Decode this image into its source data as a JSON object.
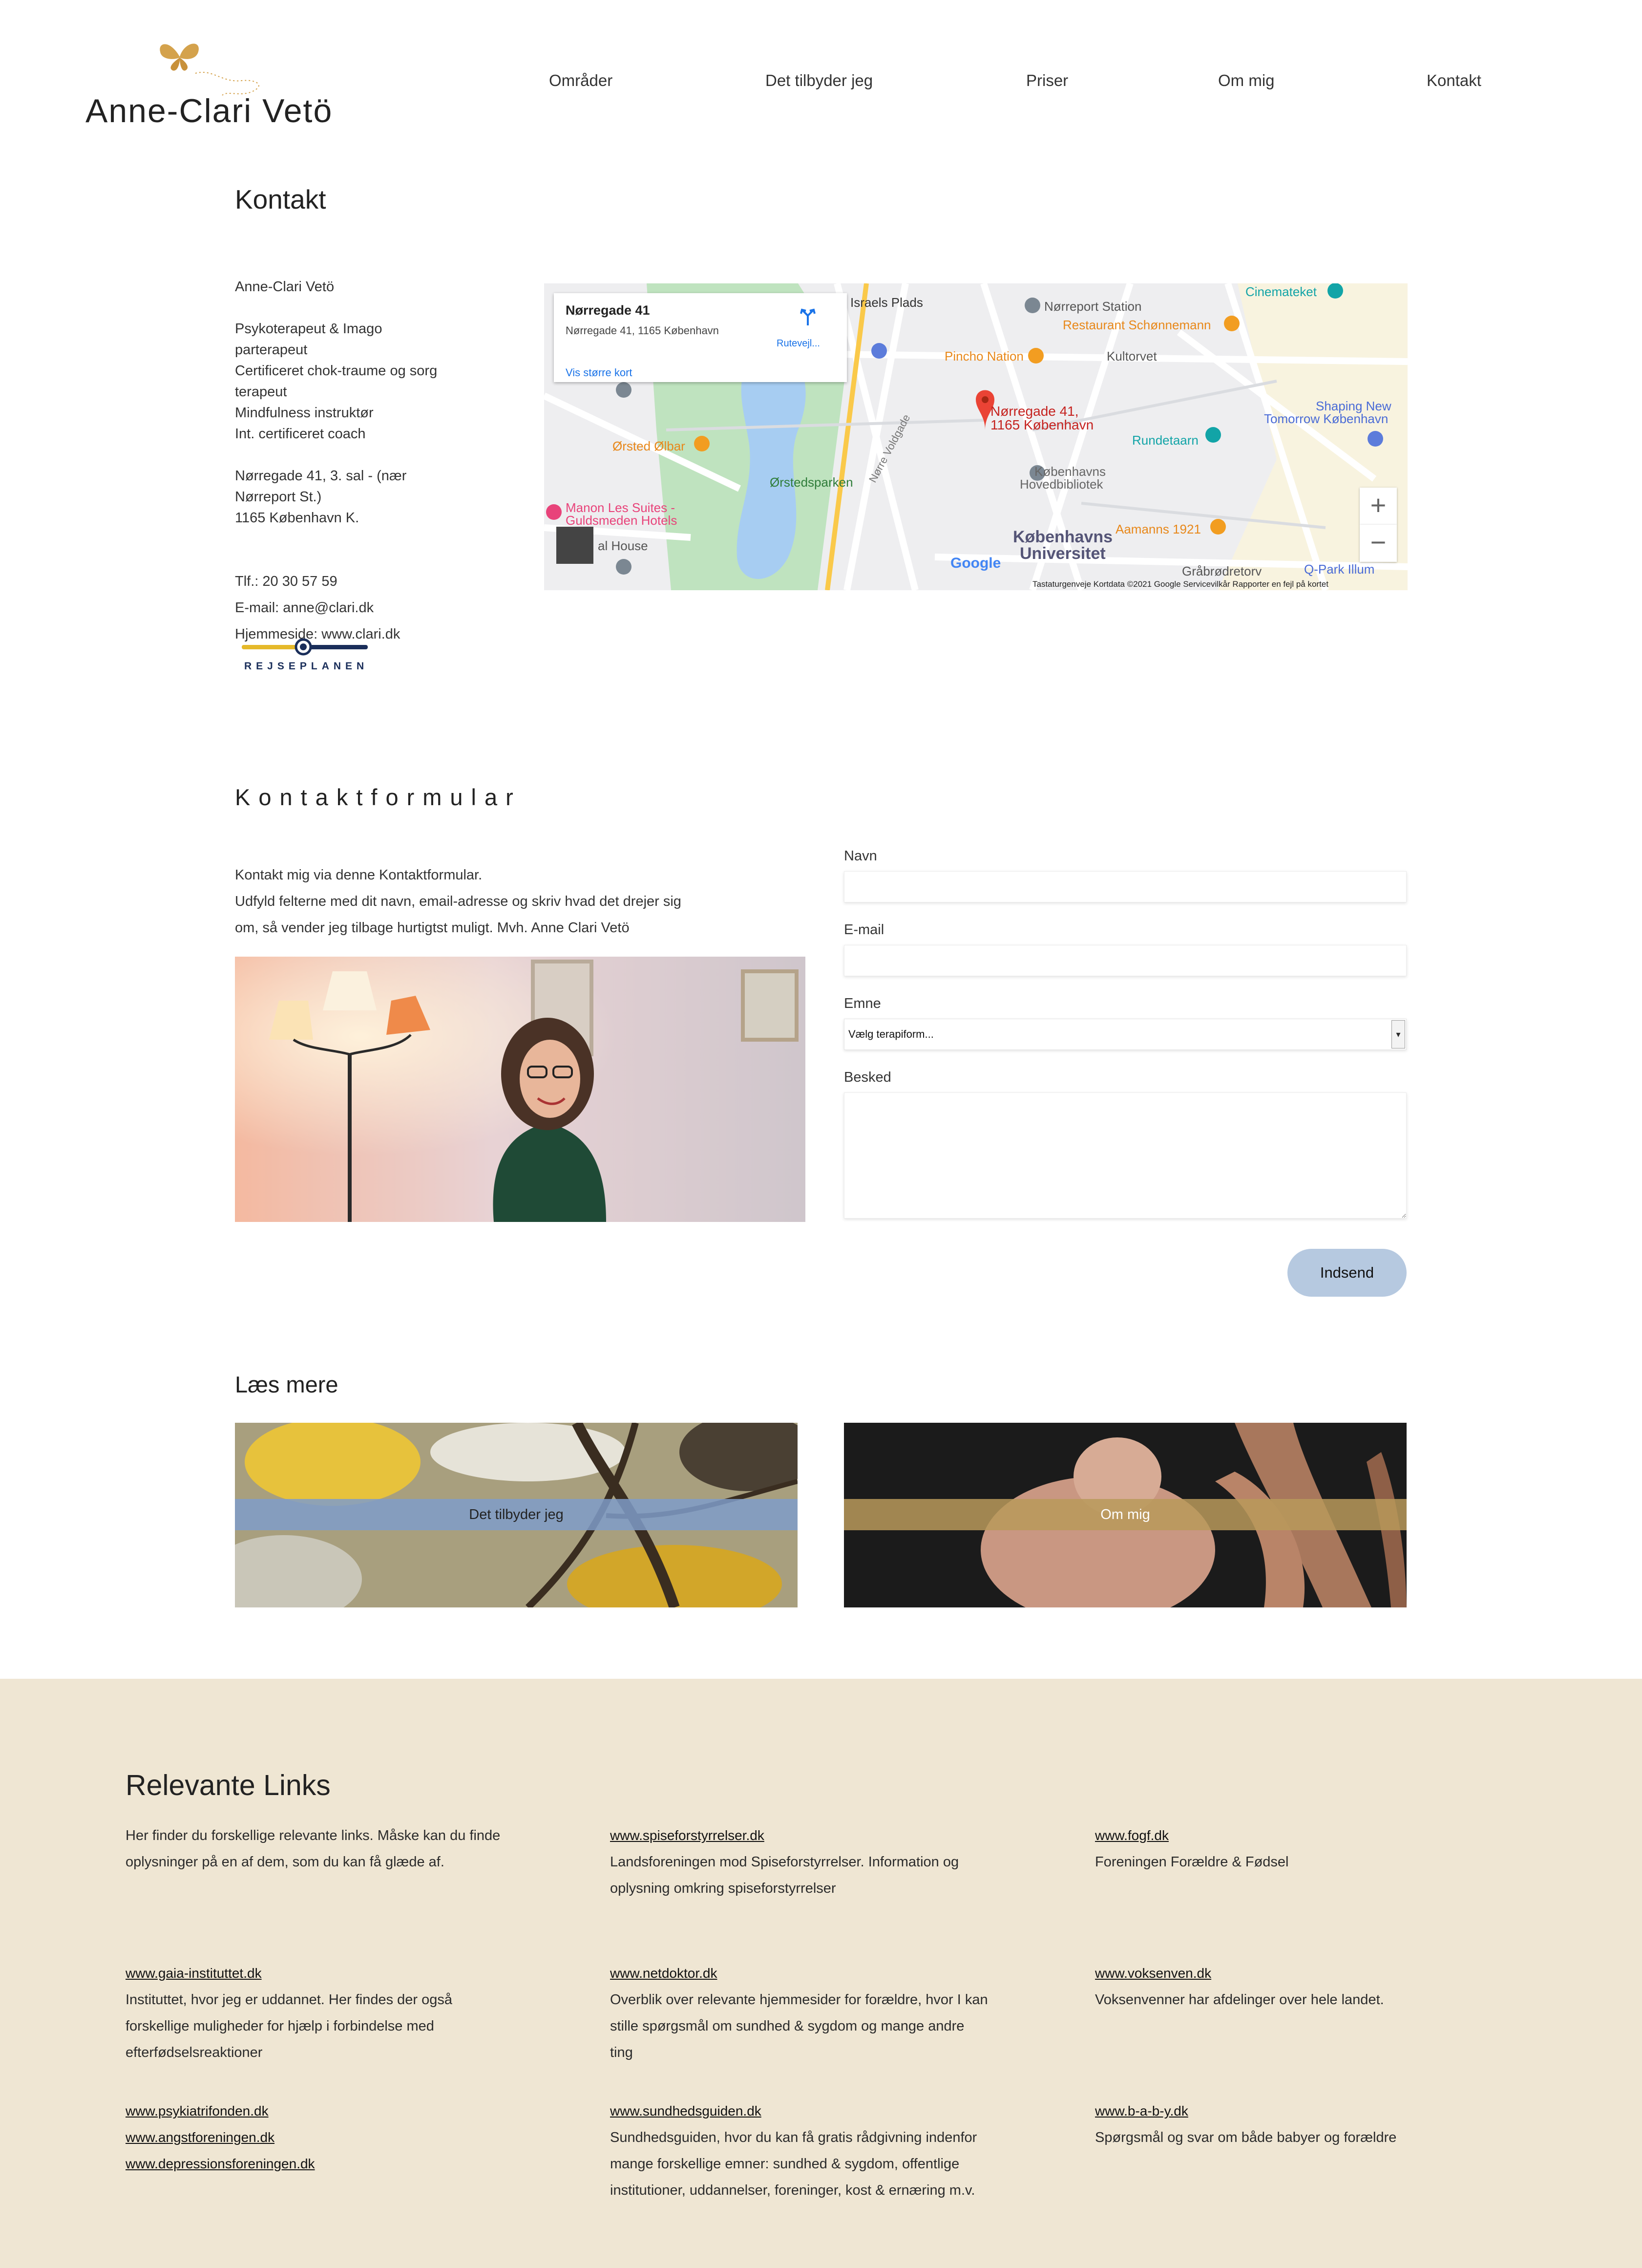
{
  "header": {
    "logo_name": "Anne-Clari Vetö",
    "nav": [
      "Områder",
      "Det tilbyder jeg",
      "Priser",
      "Om mig",
      "Kontakt"
    ]
  },
  "page_title": "Kontakt",
  "contact": {
    "name": "Anne-Clari Vetö",
    "titles": [
      "Psykoterapeut & Imago",
      "parterapeut",
      "Certificeret chok-traume og sorg",
      "terapeut",
      "Mindfulness instruktør",
      "Int. certificeret coach"
    ],
    "address": [
      "Nørregade 41, 3. sal - (nær",
      "Nørreport St.)",
      "1165 København K."
    ],
    "phone": "Tlf.: 20 30 57 59",
    "email": "E-mail: anne@clari.dk",
    "website": "Hjemmeside: www.clari.dk",
    "rejseplanen": "REJSEPLANEN"
  },
  "map": {
    "card_title": "Nørregade 41",
    "card_address": "Nørregade 41, 1165 København",
    "card_link": "Vis større kort",
    "route_label": "Rutevejl...",
    "pin_label_1": "Nørregade 41,",
    "pin_label_2": "1165 København",
    "labels": {
      "israels_plads": "Israels Plads",
      "norreport_station": "Nørreport Station",
      "cinemateket": "Cinemateket",
      "restaurant": "Restaurant Schønnemann",
      "pincho": "Pincho Nation",
      "kultorvet": "Kultorvet",
      "orsted_olbar": "Ørsted Ølbar",
      "orstedsparken": "Ørstedsparken",
      "rundetaarn": "Rundetaarn",
      "shaping_1": "Shaping New",
      "shaping_2": "Tomorrow København",
      "kbh_hovedbib_1": "Københavns",
      "kbh_hovedbib_2": "Hovedbibliotek",
      "kbh_uni_1": "Københavns",
      "kbh_uni_2": "Universitet",
      "aamanns": "Aamanns 1921",
      "manon_1": "Manon Les Suites -",
      "manon_2": "Guldsmeden Hotels",
      "noerre_voldgade": "Nørre Voldgade",
      "grabrodretorv": "Gråbrødretorv",
      "qpark": "Q-Park Illum",
      "ral_house": "al House",
      "google": "Google"
    },
    "footer": "Tastaturgenveje    Kortdata ©2021 Google    Servicevilkår    Rapporter en fejl på kortet",
    "zoom_in": "+",
    "zoom_out": "−"
  },
  "form_section": {
    "title": "Kontaktformular",
    "intro": [
      "Kontakt mig via denne Kontaktformular.",
      "Udfyld felterne med dit navn, email-adresse og skriv hvad det drejer sig",
      "om, så vender jeg tilbage hurtigtst muligt. Mvh. Anne Clari Vetö"
    ],
    "labels": {
      "name": "Navn",
      "email": "E-mail",
      "subject": "Emne",
      "message": "Besked"
    },
    "values": {
      "name": "",
      "email": "",
      "message": ""
    },
    "subject_selected": "Vælg terapiform...",
    "submit": "Indsend"
  },
  "read_more": {
    "title": "Læs mere",
    "cards": [
      "Det tilbyder jeg",
      "Om mig"
    ]
  },
  "footer": {
    "title": "Relevante Links",
    "intro": [
      "Her finder du forskellige relevante links. Måske kan du finde",
      "oplysninger på en af dem, som du kan få glæde af."
    ],
    "links": [
      {
        "url": "www.spiseforstyrrelser.dk",
        "desc": [
          "Landsforeningen mod Spiseforstyrrelser. Information og",
          "oplysning omkring spiseforstyrrelser"
        ]
      },
      {
        "url": "www.fogf.dk",
        "desc": [
          "Foreningen Forældre & Fødsel"
        ]
      },
      {
        "url": "www.gaia-instituttet.dk",
        "desc": [
          "Instituttet, hvor jeg er uddannet. Her findes der også",
          "forskellige muligheder for hjælp i forbindelse med",
          "efterfødselsreaktioner"
        ]
      },
      {
        "url": "www.netdoktor.dk",
        "desc": [
          "Overblik over relevante hjemmesider for forældre, hvor I kan",
          "stille spørgsmål om sundhed & sygdom og mange andre",
          "ting"
        ]
      },
      {
        "url": "www.voksenven.dk",
        "desc": [
          "Voksenvenner har afdelinger over hele landet."
        ]
      },
      {
        "url": "www.sundhedsguiden.dk",
        "desc": [
          "Sundhedsguiden, hvor du kan få gratis rådgivning indenfor",
          "mange forskellige emner: sundhed & sygdom, offentlige",
          "institutioner, uddannelser, foreninger, kost & ernæring m.v."
        ]
      },
      {
        "url": "www.b-a-b-y.dk",
        "desc": [
          "Spørgsmål og svar om både babyer og forældre"
        ]
      }
    ],
    "link_list": [
      "www.psykiatrifonden.dk",
      "www.angstforeningen.dk",
      "www.depressionsforeningen.dk"
    ]
  },
  "colors": {
    "accent_gold": "#d4a24c",
    "footer_bg": "#efe6d3",
    "submit_bg": "#b6c9e0",
    "card_band_blue": "#7f9cc9",
    "card_band_gold": "#b8995a"
  }
}
